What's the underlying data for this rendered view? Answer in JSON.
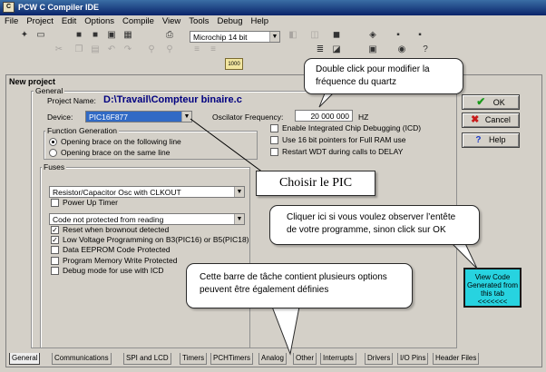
{
  "window": {
    "title": "PCW C Compiler IDE"
  },
  "menu": [
    "File",
    "Project",
    "Edit",
    "Options",
    "Compile",
    "View",
    "Tools",
    "Debug",
    "Help"
  ],
  "toolbar": {
    "chip_select": "Microchip 14 bit"
  },
  "project_window": {
    "title": "New project"
  },
  "general": {
    "group_title": "General",
    "project_name_label": "Project Name:",
    "project_name_value": "D:\\Travail\\Compteur binaire.c",
    "device_label": "Device:",
    "device_value": "PIC16F877",
    "oscillator_label": "Oscilator Frequency:",
    "oscillator_value": "20 000 000",
    "oscillator_unit": "HZ"
  },
  "function_generation": {
    "title": "Function Generation",
    "options": [
      "Opening brace on the following line",
      "Opening brace on the same line"
    ],
    "selected_index": 0
  },
  "options_right": [
    {
      "label": "Enable Integrated Chip Debugging (ICD)",
      "checked": false
    },
    {
      "label": "Use 16 bit pointers for Full RAM use",
      "checked": false
    },
    {
      "label": "Restart WDT during calls to DELAY",
      "checked": false
    }
  ],
  "fuses": {
    "title": "Fuses",
    "oscillator_select": "Resistor/Capacitor Osc with CLKOUT",
    "power_up_timer": "Power Up Timer",
    "code_protect_select": "Code not protected from reading",
    "items": [
      {
        "label": "Reset when brownout detected",
        "checked": true
      },
      {
        "label": "Low Voltage Programming on B3(PIC16) or B5(PIC18)",
        "checked": true
      },
      {
        "label": "Data EEPROM Code Protected",
        "checked": false
      },
      {
        "label": "Program Memory Write Protected",
        "checked": false
      },
      {
        "label": "Debug mode for use with ICD",
        "checked": false
      }
    ]
  },
  "buttons": {
    "ok": "OK",
    "cancel": "Cancel",
    "help": "Help"
  },
  "view_code_button": "View Code Generated from this tab <<<<<<<",
  "tabs": [
    "General",
    "Communications",
    "SPI and LCD",
    "Timers",
    "PCHTimers",
    "Analog",
    "Other",
    "Interrupts",
    "Drivers",
    "I/O Pins",
    "Header Files"
  ],
  "annotations": {
    "quartz": "Double click pour modifier la fréquence du quartz",
    "pic": "Choisir le PIC",
    "header": "Cliquer ici si vous voulez  observer l’entête de votre programme,  sinon click sur OK",
    "taskbar": "Cette barre de tâche  contient plusieurs options peuvent être également définies"
  },
  "colors": {
    "title_start": "#3a6ea5",
    "title_end": "#0a246a",
    "device_highlight": "#316ac5",
    "view_code_bg": "#27d3e0",
    "project_name_color": "#000080"
  }
}
